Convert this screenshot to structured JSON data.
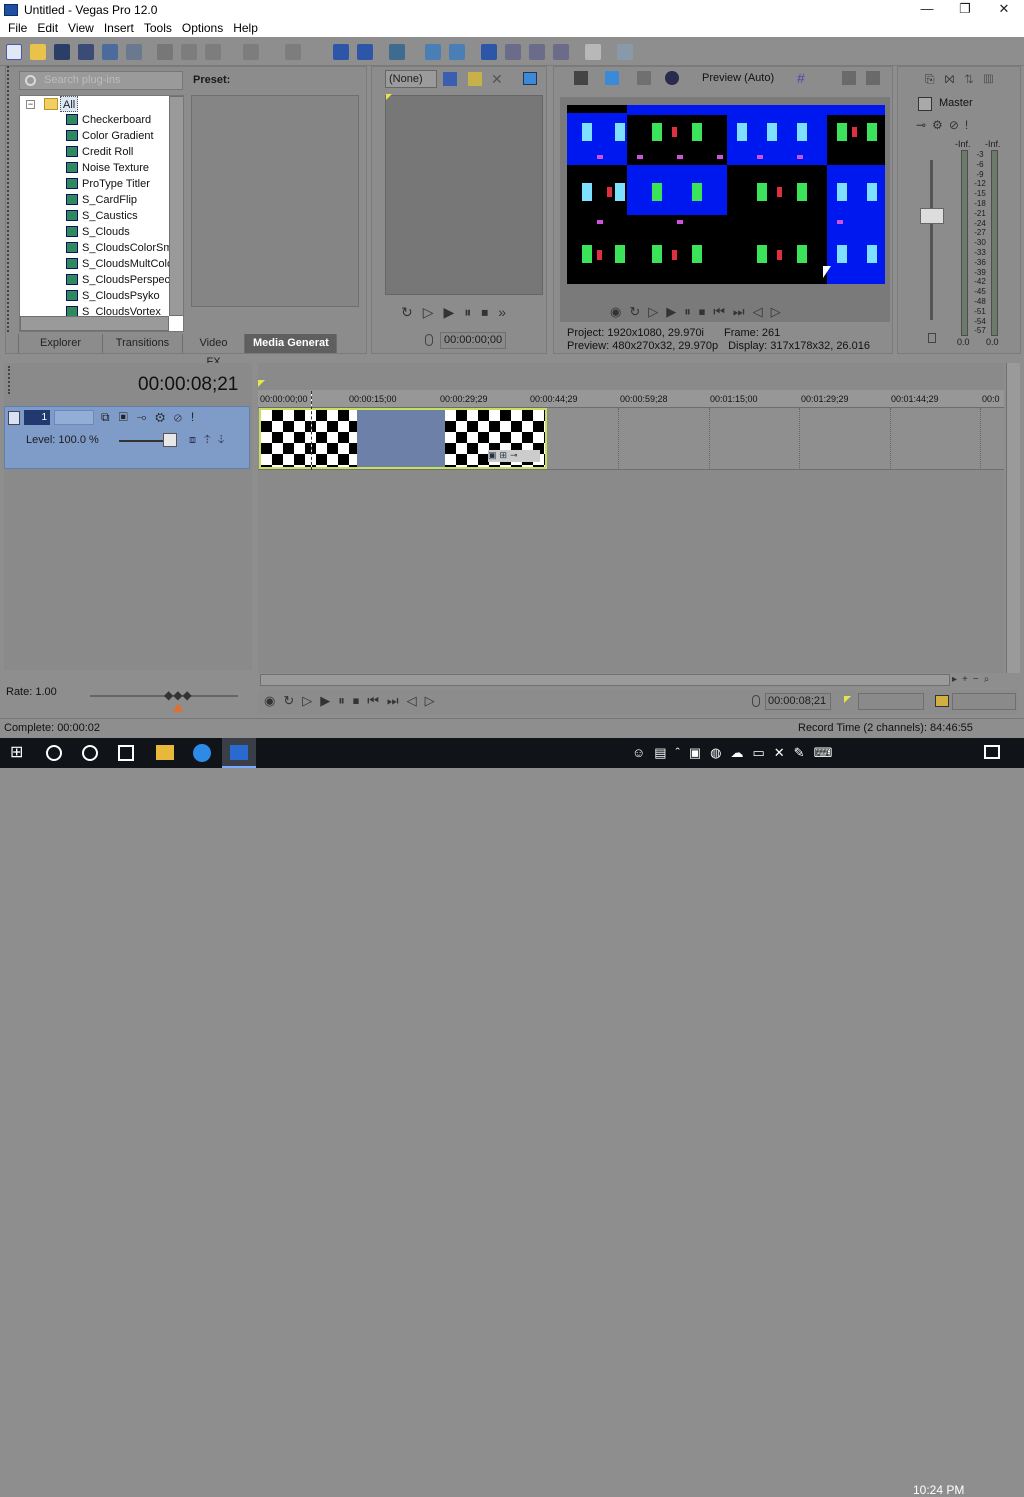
{
  "window": {
    "title": "Untitled - Vegas Pro 12.0",
    "min": "—",
    "max": "❐",
    "close": "✕"
  },
  "menu": [
    "File",
    "Edit",
    "View",
    "Insert",
    "Tools",
    "Options",
    "Help"
  ],
  "explorer": {
    "search_placeholder": "Search plug-ins",
    "preset_label": "Preset:",
    "tree_root": "All",
    "items": [
      "Checkerboard",
      "Color Gradient",
      "Credit Roll",
      "Noise Texture",
      "ProType Titler",
      "S_CardFlip",
      "S_Caustics",
      "S_Clouds",
      "S_CloudsColorSmo",
      "S_CloudsMultColor",
      "S_CloudsPerspect",
      "S_CloudsPsyko",
      "S_CloudsVortex"
    ],
    "tabs": [
      "Explorer",
      "Transitions",
      "Video FX",
      "Media Generat"
    ]
  },
  "trimmer": {
    "select_value": "(None)",
    "time": "00:00:00;00"
  },
  "preview": {
    "mode_label": "Preview (Auto)",
    "project_label": "Project:",
    "project_value": "1920x1080, 29.970i",
    "preview_label": "Preview:",
    "preview_value": "480x270x32, 29.970p",
    "frame_label": "Frame:",
    "frame_value": "261",
    "display_label": "Display:",
    "display_value": "317x178x32, 26.016"
  },
  "mixer": {
    "master_label": "Master",
    "peak_left": "-Inf.",
    "peak_right": "-Inf.",
    "scale": [
      "3",
      "6",
      "9",
      "12",
      "15",
      "18",
      "21",
      "24",
      "27",
      "30",
      "33",
      "36",
      "39",
      "42",
      "45",
      "48",
      "51",
      "54",
      "57"
    ],
    "level_left": "0.0",
    "level_right": "0.0"
  },
  "timeline": {
    "timecode": "00:00:08;21",
    "ruler": [
      "00:00:00;00",
      "00:00:15;00",
      "00:00:29;29",
      "00:00:44;29",
      "00:00:59;28",
      "00:01:15;00",
      "00:01:29;29",
      "00:01:44;29",
      "00:0"
    ],
    "track": {
      "number": "1",
      "level_label": "Level: 100.0 %"
    },
    "rate_label": "Rate: 1.00",
    "transport_time": "00:00:08;21"
  },
  "status": {
    "complete": "Complete: 00:00:02",
    "record_time": "Record Time (2 channels): 84:46:55"
  },
  "taskbar": {
    "clock": "10:24 PM"
  },
  "colors": {
    "panel": "#8e8e8e",
    "track_header": "#7f9bc8",
    "preview_blue": "#0018f0",
    "accent_yellow": "#c8e060"
  }
}
